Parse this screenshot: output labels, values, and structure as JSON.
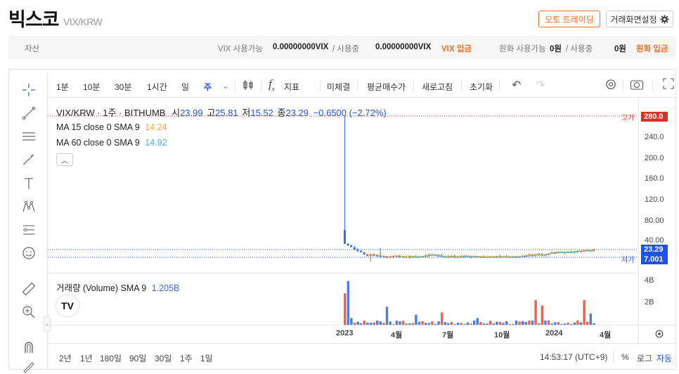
{
  "header": {
    "title": "빅스코",
    "subtitle": "VIX/KRW",
    "auto_trading": "오토 트레이딩",
    "screen_settings": "거래화면설정"
  },
  "balance": {
    "label_asset": "자산",
    "vix_available_label": "VIX 사용가능",
    "vix_available_value": "0.00000000VIX",
    "in_use_label": "/ 사용중",
    "vix_in_use_value": "0.00000000VIX",
    "vix_deposit": "VIX 입금",
    "krw_available_label": "원화 사용가능",
    "krw_available_value": "0원",
    "krw_in_use_label": "/ 사용중",
    "krw_in_use_value": "0원",
    "krw_deposit": "원화 입금"
  },
  "toolbar": {
    "intervals": [
      "1분",
      "10분",
      "30분",
      "1시간",
      "일",
      "주"
    ],
    "active_interval": "주",
    "indicators": "지표",
    "items": [
      "미체결",
      "평균매수가",
      "새로고침",
      "초기화"
    ]
  },
  "legend": {
    "symbol": "VIX/KRW · 1주 · BITHUMB",
    "open_label": "시",
    "open": "23.99",
    "high_label": "고",
    "high": "25.81",
    "low_label": "저",
    "low": "15.52",
    "close_label": "종",
    "close": "23.29",
    "change": "−0.6500 (−2.72%)",
    "ma15_label": "MA 15 close 0 SMA 9",
    "ma15_value": "14.24",
    "ma60_label": "MA 60 close 0 SMA 9",
    "ma60_value": "14.92",
    "volume_label": "거래량 (Volume) SMA 9",
    "volume_value": "1.205B"
  },
  "price_axis": {
    "ticks": [
      "280.0",
      "240.0",
      "200.0",
      "160.0",
      "120.0",
      "80.00",
      "40.00"
    ],
    "high_marker_label": "고가",
    "high_marker_value": "280.0",
    "last_price": "23.29",
    "low_marker_label": "저가",
    "low_marker_value": "7.001"
  },
  "volume_axis": {
    "ticks": [
      "4B",
      "2B"
    ]
  },
  "time_axis": {
    "labels": [
      "2023",
      "4월",
      "7월",
      "10월",
      "2024",
      "4월"
    ]
  },
  "bottom": {
    "ranges": [
      "2년",
      "1년",
      "180일",
      "90일",
      "30일",
      "1주",
      "1일"
    ],
    "clock": "14:53:17 (UTC+9)",
    "percent": "%",
    "log": "로그",
    "auto": "자동"
  },
  "colors": {
    "accent": "#f26d21",
    "up": "#e8523b",
    "down": "#3a6fe0",
    "ma15": "#f2a33a",
    "ma60": "#40b4d6",
    "last_price_tag": "#1e53e5",
    "high_tag": "#d9322b"
  }
}
